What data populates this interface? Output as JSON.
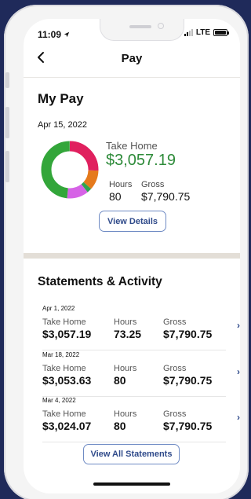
{
  "status": {
    "time": "11:09",
    "network": "LTE"
  },
  "nav": {
    "title": "Pay"
  },
  "my_pay": {
    "title": "My Pay",
    "date": "Apr 15, 2022",
    "take_home_label": "Take Home",
    "take_home_value": "$3,057.19",
    "hours_label": "Hours",
    "hours_value": "80",
    "gross_label": "Gross",
    "gross_value": "$7,790.75",
    "view_details": "View Details",
    "breakdown_colors": [
      "#e0205e",
      "#e57a1c",
      "#2ea44f",
      "#d663e6",
      "#33a63a"
    ]
  },
  "statements": {
    "title": "Statements & Activity",
    "rows": [
      {
        "date": "Apr 1, 2022",
        "take_home_label": "Take Home",
        "take_home": "$3,057.19",
        "hours_label": "Hours",
        "hours": "73.25",
        "gross_label": "Gross",
        "gross": "$7,790.75"
      },
      {
        "date": "Mar 18, 2022",
        "take_home_label": "Take Home",
        "take_home": "$3,053.63",
        "hours_label": "Hours",
        "hours": "80",
        "gross_label": "Gross",
        "gross": "$7,790.75"
      },
      {
        "date": "Mar 4, 2022",
        "take_home_label": "Take Home",
        "take_home": "$3,024.07",
        "hours_label": "Hours",
        "hours": "80",
        "gross_label": "Gross",
        "gross": "$7,790.75"
      }
    ],
    "view_all": "View All Statements"
  },
  "colors": {
    "accent": "#2f4a8a",
    "take_home_green": "#2e8b3a",
    "background": "#1f2a5a"
  }
}
